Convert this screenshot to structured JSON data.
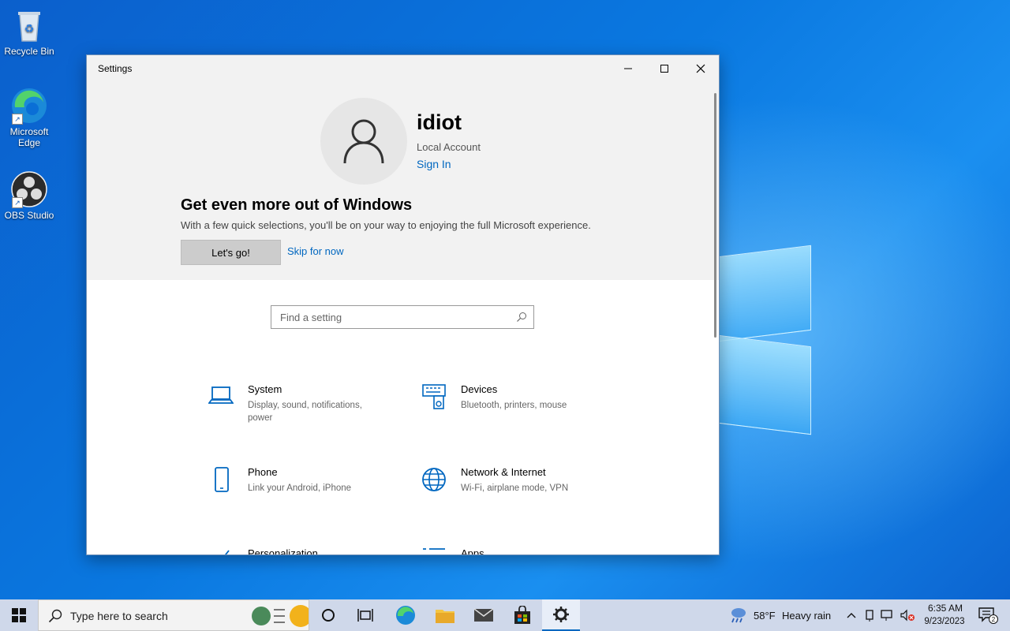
{
  "desktop": {
    "icons": [
      {
        "label": "Recycle Bin",
        "icon": "recycle-bin-icon"
      },
      {
        "label": "Microsoft Edge",
        "icon": "edge-icon"
      },
      {
        "label": "OBS Studio",
        "icon": "obs-studio-icon"
      }
    ]
  },
  "window": {
    "title": "Settings",
    "controls": [
      "minimize-icon",
      "maximize-icon",
      "close-icon"
    ]
  },
  "account": {
    "name": "idiot",
    "type": "Local Account",
    "sign_in": "Sign In"
  },
  "promo": {
    "title": "Get even more out of Windows",
    "description": "With a few quick selections, you'll be on your way to enjoying the full Microsoft experience.",
    "primary_button": "Let's go!",
    "secondary_link": "Skip for now"
  },
  "search": {
    "placeholder": "Find a setting"
  },
  "categories": [
    {
      "title": "System",
      "description": "Display, sound, notifications, power",
      "icon": "laptop-icon"
    },
    {
      "title": "Devices",
      "description": "Bluetooth, printers, mouse",
      "icon": "keyboard-speaker-icon"
    },
    {
      "title": "Phone",
      "description": "Link your Android, iPhone",
      "icon": "phone-icon"
    },
    {
      "title": "Network & Internet",
      "description": "Wi-Fi, airplane mode, VPN",
      "icon": "globe-icon"
    },
    {
      "title": "Personalization",
      "description": "",
      "icon": "brush-icon"
    },
    {
      "title": "Apps",
      "description": "",
      "icon": "apps-list-icon"
    }
  ],
  "taskbar": {
    "search_placeholder": "Type here to search",
    "weather_temp": "58°F",
    "weather_condition": "Heavy rain",
    "time": "6:35 AM",
    "date": "9/23/2023",
    "notification_count": "2"
  },
  "colors": {
    "accent": "#0067c0",
    "desktop": "#0a6fd6",
    "taskbar": "#cfd8ea"
  }
}
